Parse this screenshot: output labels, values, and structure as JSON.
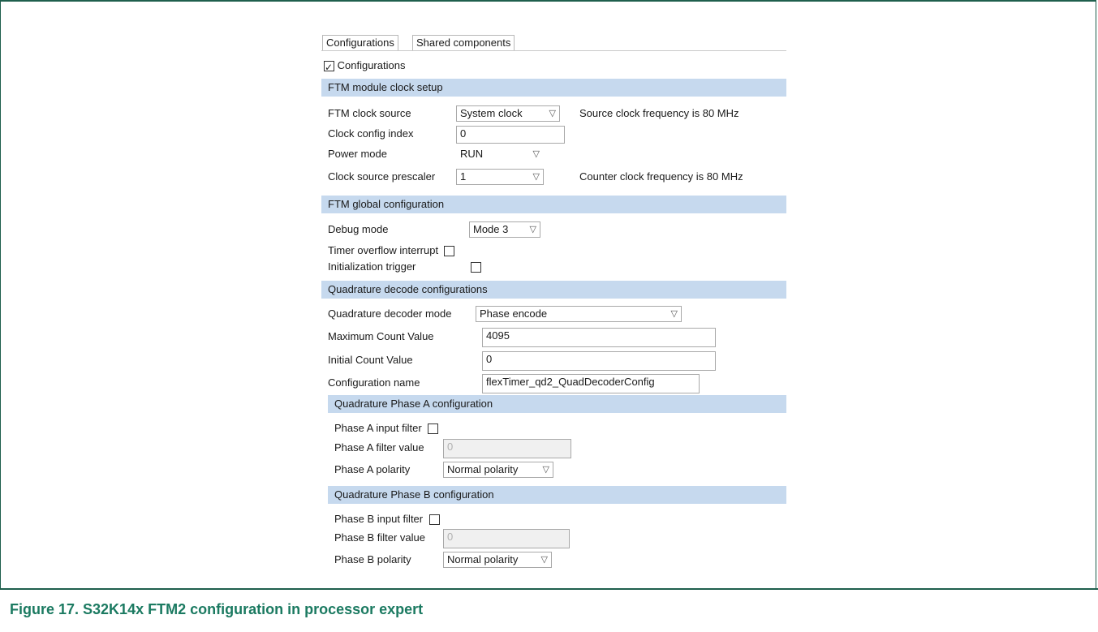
{
  "tabs": [
    "Configurations",
    "Shared components"
  ],
  "root_checkbox_label": "Configurations",
  "sections": {
    "clock": "FTM module clock setup",
    "global": "FTM global configuration",
    "quad": "Quadrature decode configurations",
    "phaseA": "Quadrature Phase A configuration",
    "phaseB": "Quadrature Phase B configuration"
  },
  "clock": {
    "source_label": "FTM clock source",
    "source_value": "System clock",
    "source_note": "Source clock frequency is 80 MHz",
    "index_label": "Clock config index",
    "index_value": "0",
    "power_label": "Power mode",
    "power_value": "RUN",
    "prescaler_label": "Clock source prescaler",
    "prescaler_value": "1",
    "prescaler_note": "Counter clock frequency is 80 MHz"
  },
  "global": {
    "debug_label": "Debug mode",
    "debug_value": "Mode 3",
    "overflow_label": "Timer overflow interrupt",
    "init_label": "Initialization trigger"
  },
  "quad": {
    "mode_label": "Quadrature decoder mode",
    "mode_value": "Phase encode",
    "max_label": "Maximum Count Value",
    "max_value": "4095",
    "init_label": "Initial Count Value",
    "init_value": "0",
    "name_label": "Configuration name",
    "name_value": "flexTimer_qd2_QuadDecoderConfig"
  },
  "phaseA": {
    "filter_label": "Phase A input filter",
    "value_label": "Phase A filter value",
    "value": "0",
    "polarity_label": "Phase A polarity",
    "polarity_value": "Normal polarity"
  },
  "phaseB": {
    "filter_label": "Phase B input filter",
    "value_label": "Phase B filter value",
    "value": "0",
    "polarity_label": "Phase B polarity",
    "polarity_value": "Normal polarity"
  },
  "caption": "Figure 17. S32K14x FTM2 configuration in processor expert"
}
